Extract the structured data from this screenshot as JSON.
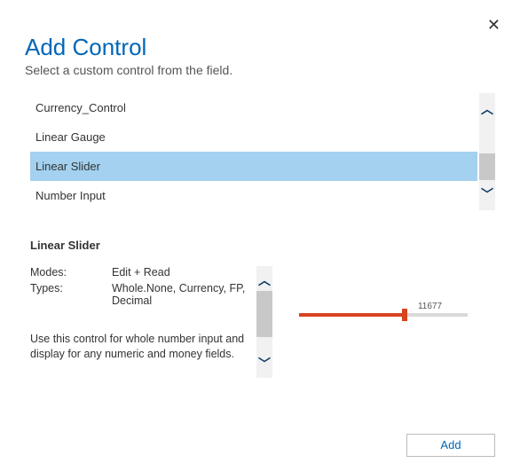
{
  "close_glyph": "✕",
  "title": "Add Control",
  "subtitle": "Select a custom control from the field.",
  "controls": [
    {
      "label": "Currency_Control",
      "selected": false
    },
    {
      "label": "Linear Gauge",
      "selected": false
    },
    {
      "label": "Linear Slider",
      "selected": true
    },
    {
      "label": "Number Input",
      "selected": false
    }
  ],
  "detail": {
    "title": "Linear Slider",
    "modes_label": "Modes:",
    "modes_value": "Edit + Read",
    "types_label": "Types:",
    "types_value": "Whole.None, Currency, FP, Decimal",
    "description": "Use this control for whole number input and display for any numeric and money fields."
  },
  "preview": {
    "value": "11677"
  },
  "footer": {
    "add_label": "Add"
  }
}
